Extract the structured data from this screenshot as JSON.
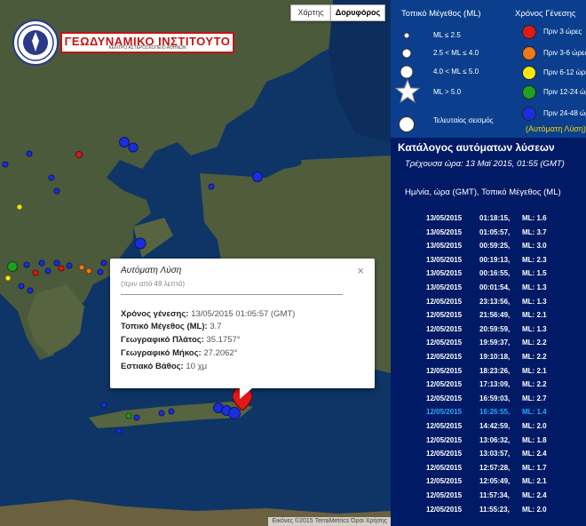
{
  "map_type": {
    "map_label": "Χάρτης",
    "satellite_label": "Δορυφόρος"
  },
  "logo": {
    "title": "ΓΕΩΔΥΝΑΜΙΚΟ ΙΝΣΤΙΤΟΥΤΟ",
    "subtitle": "ΚΕΝΤΡΟ ΑΣΤΕΡΟΣΚΟΠΕΙΟ ΑΘΗΝΩΝ"
  },
  "colors": {
    "sea": "#0f3566",
    "land": "#4a5a3a",
    "legend_bg": "#0b3f8e",
    "catalog_bg": "#001a66",
    "age_0_3": "#e01818",
    "age_3_6": "#f07818",
    "age_6_12": "#f5e614",
    "age_12_24": "#1fa01f",
    "age_24_48": "#1a2ee0",
    "highlight": "#29a8ff",
    "auto": "#f5d200"
  },
  "legend": {
    "mag_header": "Τοπικό Μέγεθος (ML)",
    "age_header": "Χρόνος Γένεσης",
    "mag_items": [
      {
        "label": "ML ≤ 2.5"
      },
      {
        "label": "2.5 < ML ≤ 4.0"
      },
      {
        "label": "4.0 < ML ≤ 5.0"
      },
      {
        "label": "ML > 5.0"
      },
      {
        "label": "Τελευταίος σεισμός"
      }
    ],
    "age_items": [
      {
        "label": "Πριν 3 ώρες",
        "color": "#e01818"
      },
      {
        "label": "Πριν 3-6 ώρες",
        "color": "#f07818"
      },
      {
        "label": "Πριν 6-12 ώρες",
        "color": "#f5e614"
      },
      {
        "label": "Πριν 12-24 ώρες",
        "color": "#1fa01f"
      },
      {
        "label": "Πριν 24-48 ώρες",
        "color": "#1a2ee0"
      }
    ],
    "auto_note": "(Αυτόματη Λύση)"
  },
  "popup": {
    "title": "Αυτόματη Λύση",
    "ago": "(πριν από 49 λεπτά)",
    "origin_time_label": "Χρόνος γένεσης:",
    "origin_time": "13/05/2015 01:05:57 (GMT)",
    "magnitude_label": "Τοπικό Μέγεθος (ML):",
    "magnitude": "3.7",
    "latitude_label": "Γεωγραφικό Πλάτος:",
    "latitude": "35.1757°",
    "longitude_label": "Γεωγραφικό Μήκος:",
    "longitude": "27.2062°",
    "depth_label": "Εστιακό Βάθος:",
    "depth": "10 χμ"
  },
  "attribution": "Εικόνες ©2015 TerraMetrics   Όροι Χρήσης",
  "catalog": {
    "title": "Κατάλογος αυτόματων λύσεων",
    "current_time": "Τρέχουσα ώρα: 13 Μαϊ 2015, 01:55 (GMT)",
    "header": "Ημ/νία, ώρα (GMT), Τοπικό Μέγεθος (ML)",
    "rows": [
      {
        "date": "13/05/2015",
        "time": "01:18:15,",
        "ml": "ML: 1.6"
      },
      {
        "date": "13/05/2015",
        "time": "01:05:57,",
        "ml": "ML: 3.7"
      },
      {
        "date": "13/05/2015",
        "time": "00:59:25,",
        "ml": "ML: 3.0"
      },
      {
        "date": "13/05/2015",
        "time": "00:19:13,",
        "ml": "ML: 2.3"
      },
      {
        "date": "13/05/2015",
        "time": "00:16:55,",
        "ml": "ML: 1.5"
      },
      {
        "date": "13/05/2015",
        "time": "00:01:54,",
        "ml": "ML: 1.3"
      },
      {
        "date": "12/05/2015",
        "time": "23:13:56,",
        "ml": "ML: 1.3"
      },
      {
        "date": "12/05/2015",
        "time": "21:56:49,",
        "ml": "ML: 2.1"
      },
      {
        "date": "12/05/2015",
        "time": "20:59:59,",
        "ml": "ML: 1.3"
      },
      {
        "date": "12/05/2015",
        "time": "19:59:37,",
        "ml": "ML: 2.2"
      },
      {
        "date": "12/05/2015",
        "time": "19:10:18,",
        "ml": "ML: 2.2"
      },
      {
        "date": "12/05/2015",
        "time": "18:23:26,",
        "ml": "ML: 2.1"
      },
      {
        "date": "12/05/2015",
        "time": "17:13:09,",
        "ml": "ML: 2.2"
      },
      {
        "date": "12/05/2015",
        "time": "16:59:03,",
        "ml": "ML: 2.7"
      },
      {
        "date": "12/05/2015",
        "time": "16:26:55,",
        "ml": "ML: 1.4",
        "highlight": true
      },
      {
        "date": "12/05/2015",
        "time": "14:42:59,",
        "ml": "ML: 2.0"
      },
      {
        "date": "12/05/2015",
        "time": "13:06:32,",
        "ml": "ML: 1.8"
      },
      {
        "date": "12/05/2015",
        "time": "13:03:57,",
        "ml": "ML: 2.4"
      },
      {
        "date": "12/05/2015",
        "time": "12:57:28,",
        "ml": "ML: 1.7"
      },
      {
        "date": "12/05/2015",
        "time": "12:05:49,",
        "ml": "ML: 2.1"
      },
      {
        "date": "12/05/2015",
        "time": "11:57:34,",
        "ml": "ML: 2.4"
      },
      {
        "date": "12/05/2015",
        "time": "11:55:23,",
        "ml": "ML: 2.0"
      }
    ]
  }
}
